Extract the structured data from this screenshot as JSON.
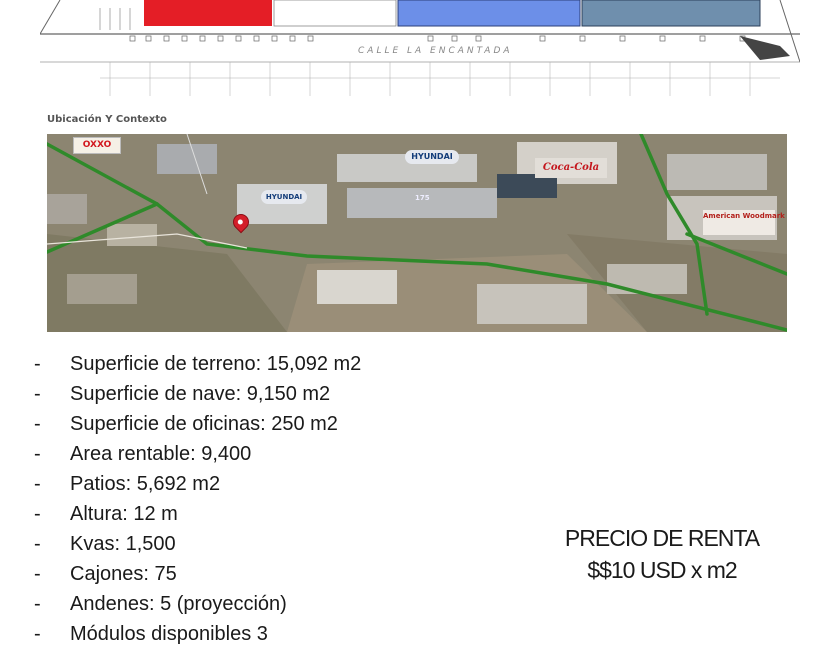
{
  "plan": {
    "street_label": "CALLE LA ENCANTADA"
  },
  "context": {
    "title": "Ubicación Y Contexto"
  },
  "map": {
    "brands": {
      "oxxo": "OXXO",
      "hyundai_1": "HYUNDAI",
      "hyundai_2": "HYUNDAI",
      "coca_cola": "Coca-Cola",
      "american_woodmark": "American Woodmark",
      "building_175": "175"
    }
  },
  "specs": [
    {
      "bullet": "-",
      "text": "Superficie de terreno: 15,092 m2"
    },
    {
      "bullet": "-",
      "text": "Superficie de nave: 9,150 m2"
    },
    {
      "bullet": "-",
      "text": "Superficie de oficinas: 250 m2"
    },
    {
      "bullet": "-",
      "text": "Area rentable: 9,400"
    },
    {
      "bullet": "-",
      "text": "Patios: 5,692 m2"
    },
    {
      "bullet": "-",
      "text": "Altura: 12 m"
    },
    {
      "bullet": "-",
      "text": "Kvas: 1,500"
    },
    {
      "bullet": "-",
      "text": "Cajones: 75"
    },
    {
      "bullet": "-",
      "text": "Andenes: 5 (proyección)"
    },
    {
      "bullet": "-",
      "text": "Módulos disponibles 3"
    }
  ],
  "price": {
    "label": "PRECIO DE RENTA",
    "value": "$$10 USD x m2"
  },
  "colors": {
    "module_red": "#e41e26",
    "module_blue": "#6c8fe8",
    "module_steel": "#6f8fad",
    "road_green": "#2f8a2a",
    "pin_red": "#d41f2a"
  }
}
